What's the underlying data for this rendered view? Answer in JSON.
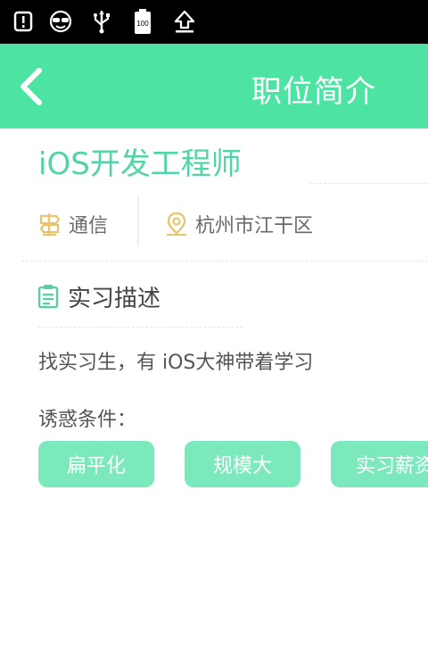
{
  "status_bar": {
    "icons": [
      "alert-icon",
      "glasses-face-icon",
      "usb-icon",
      "battery-icon",
      "upload-icon"
    ],
    "battery_text": "100"
  },
  "header": {
    "back_icon": "chevron-left-icon",
    "title": "职位简介",
    "color": "#4de3a3"
  },
  "job": {
    "title": "iOS开发工程师",
    "industry": "通信",
    "location": "杭州市江干区"
  },
  "description": {
    "heading": "实习描述",
    "text": "找实习生，有 iOS大神带着学习",
    "perks_label": "诱惑条件：",
    "perks": [
      "扁平化",
      "规模大",
      "实习薪资"
    ]
  }
}
